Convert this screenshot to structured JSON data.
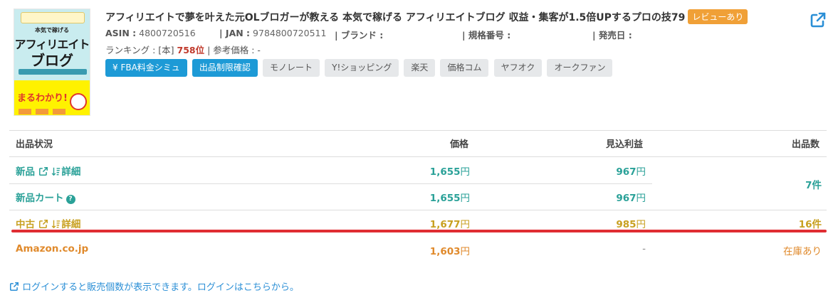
{
  "product": {
    "title": "アフィリエイトで夢を叶えた元OLブロガーが教える 本気で稼げる アフィリエイトブログ 収益・集客が1.5倍UPするプロの技79",
    "review_badge": "レビューあり",
    "cover": {
      "line1": "本気で稼げる",
      "line2": "アフィリエイト",
      "line3": "ブログ",
      "line4": "まるわかり!"
    },
    "meta": {
      "asin_label": "ASIN :",
      "asin": "4800720516",
      "jan_label": "| JAN :",
      "jan": "9784800720511",
      "brand_label": "| ブランド :",
      "model_label": "| 規格番号 :",
      "release_label": "| 発売日 :"
    },
    "ranking": {
      "label": "ランキング : [本] ",
      "value": "758位",
      "ref_price": " | 参考価格 : -"
    }
  },
  "buttons": [
    {
      "label": "¥ FBA料金シミュ",
      "style": "blue"
    },
    {
      "label": "出品制限確認",
      "style": "blue"
    },
    {
      "label": "モノレート",
      "style": "gray"
    },
    {
      "label": "Y!ショッピング",
      "style": "gray"
    },
    {
      "label": "楽天",
      "style": "gray"
    },
    {
      "label": "価格コム",
      "style": "gray"
    },
    {
      "label": "ヤフオク",
      "style": "gray"
    },
    {
      "label": "オークファン",
      "style": "gray"
    }
  ],
  "table": {
    "headers": {
      "condition": "出品状況",
      "price": "価格",
      "profit": "見込利益",
      "count": "出品数"
    },
    "rows": [
      {
        "condition": "新品",
        "detail": "詳細",
        "price": "1,655",
        "profit": "967"
      },
      {
        "condition": "新品カート",
        "price": "1,655",
        "profit": "967"
      },
      {
        "condition": "中古",
        "detail": "詳細",
        "price": "1,677",
        "profit": "985",
        "count": "16件"
      },
      {
        "condition": "Amazon.co.jp",
        "price": "1,603",
        "profit": "-",
        "count": "在庫あり"
      }
    ],
    "new_count": "7件",
    "yen": "円"
  },
  "login_note": "ログインすると販売個数が表示できます。ログインはこちらから。",
  "colors": {
    "accent_blue": "#1d9ad6",
    "new_teal": "#2aa198",
    "used_gold": "#c8a020",
    "amazon_orange": "#e08a2c",
    "highlight_red": "#e02d33",
    "badge_orange": "#f0a037"
  }
}
